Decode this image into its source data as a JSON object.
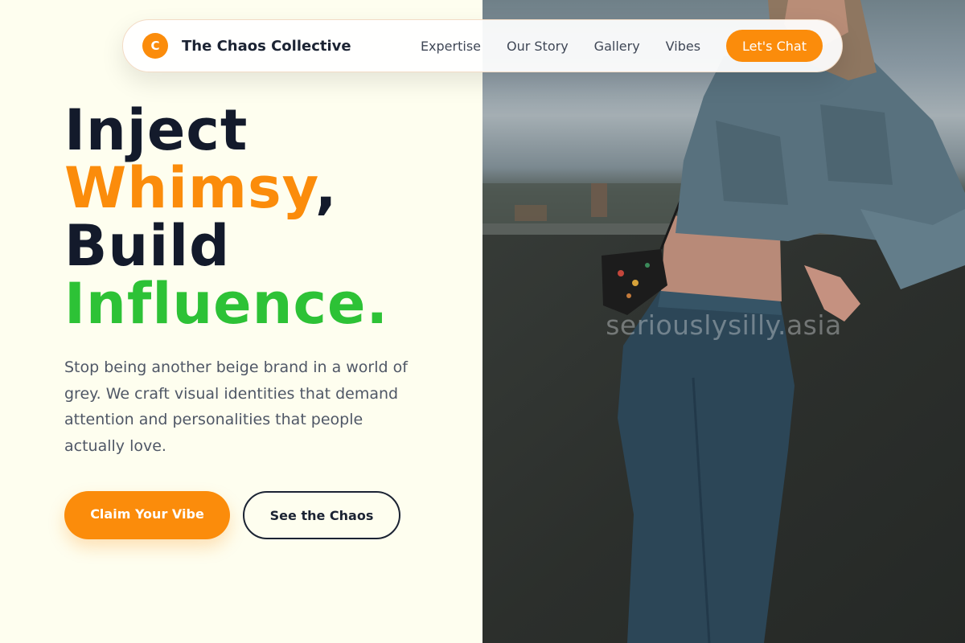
{
  "nav": {
    "logo_letter": "C",
    "brand": "The Chaos Collective",
    "links": [
      "Expertise",
      "Our Story",
      "Gallery",
      "Vibes"
    ],
    "cta": "Let's Chat"
  },
  "hero": {
    "line1": "Inject",
    "line2_accent": "Whimsy",
    "line2_punct": ",",
    "line3": "Build",
    "line4_accent": "Influence.",
    "description": "Stop being another beige brand in a world of grey. We craft visual identities that demand attention and personalities that people actually love.",
    "primary_button": "Claim Your Vibe",
    "secondary_button": "See the Chaos"
  },
  "photo": {
    "watermark": "seriouslysilly.asia"
  },
  "colors": {
    "accent_orange": "#fb8c0b",
    "accent_green": "#2dc236",
    "dark": "#131a2b",
    "background": "#fefeef"
  }
}
